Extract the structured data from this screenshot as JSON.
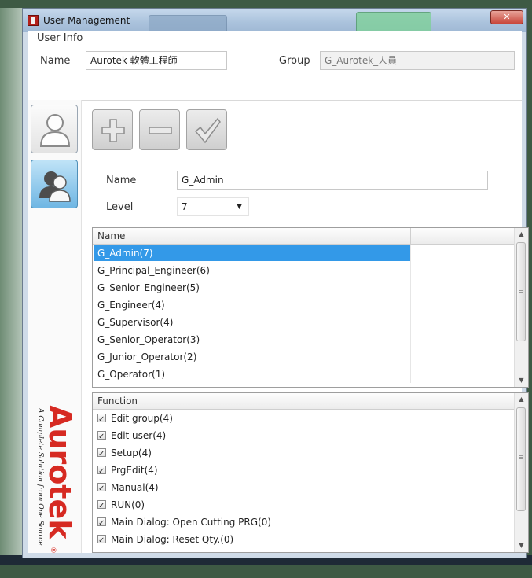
{
  "window": {
    "title": "User Management",
    "close_glyph": "✕"
  },
  "user_info": {
    "section_label": "User Info",
    "name_label": "Name",
    "name_value": "Aurotek 軟體工程師",
    "group_label": "Group",
    "group_value": "G_Aurotek_人員"
  },
  "sidebar": {
    "user_button_icon": "user-icon",
    "group_button_icon": "group-icon",
    "logo_brand": "Aurotek",
    "logo_tagline": "A Complete Solution from One Source",
    "logo_registered": "®",
    "logo_color": "#d62a22"
  },
  "toolbar": {
    "add_icon": "plus-icon",
    "remove_icon": "minus-icon",
    "confirm_icon": "check-icon"
  },
  "group_form": {
    "name_label": "Name",
    "name_value": "G_Admin",
    "level_label": "Level",
    "level_value": "7",
    "level_arrow": "▼"
  },
  "group_list": {
    "header": "Name",
    "rows": [
      "G_Admin(7)",
      "G_Principal_Engineer(6)",
      "G_Senior_Engineer(5)",
      "G_Engineer(4)",
      "G_Supervisor(4)",
      "G_Senior_Operator(3)",
      "G_Junior_Operator(2)",
      "G_Operator(1)"
    ],
    "selected_index": 0,
    "selection_color": "#3399e8"
  },
  "function_list": {
    "header": "Function",
    "rows": [
      "Edit group(4)",
      "Edit user(4)",
      "Setup(4)",
      "PrgEdit(4)",
      "Manual(4)",
      "RUN(0)",
      "Main Dialog: Open Cutting PRG(0)",
      "Main Dialog: Reset Qty.(0)"
    ],
    "all_checked": true
  },
  "scroll": {
    "up": "▲",
    "down": "▼"
  }
}
